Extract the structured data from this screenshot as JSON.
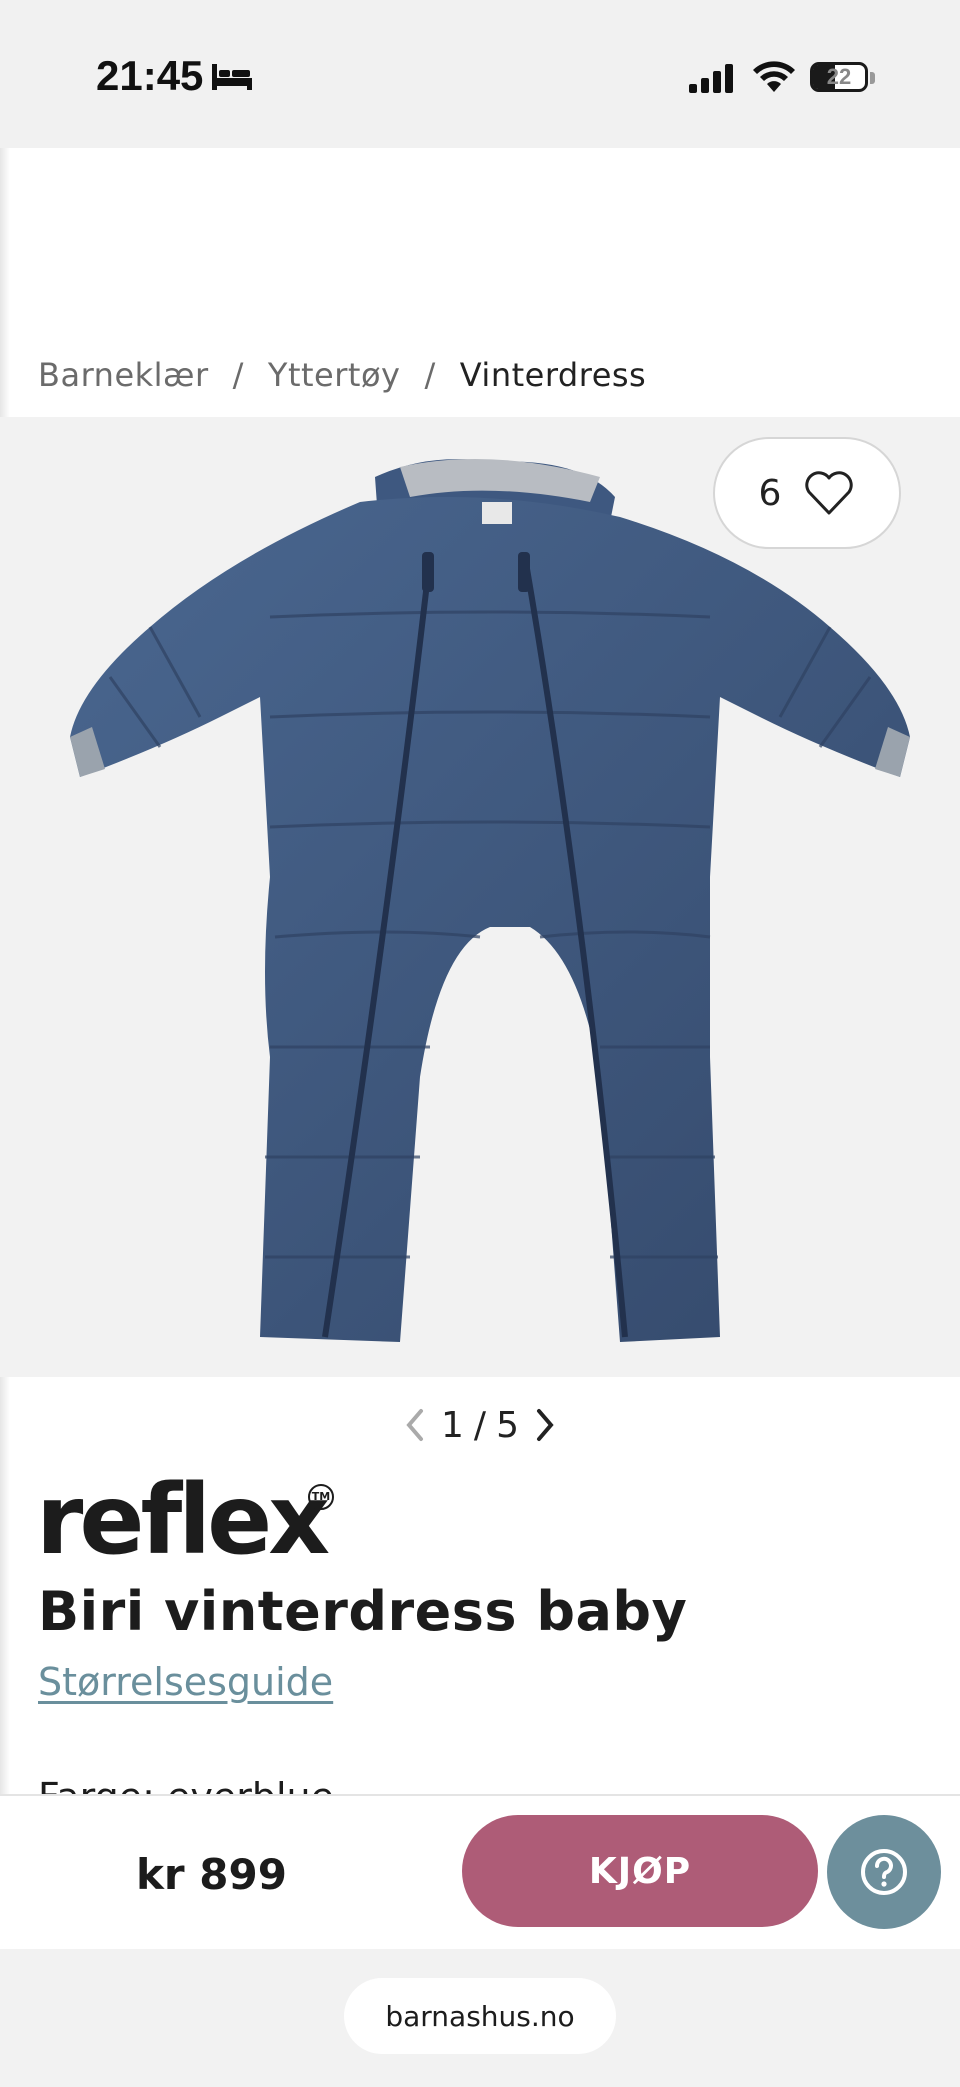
{
  "status_bar": {
    "time": "21:45",
    "battery": "22",
    "icons": [
      "bed-icon",
      "signal-icon",
      "wifi-icon",
      "battery-icon"
    ]
  },
  "breadcrumb": {
    "items": [
      "Barneklær",
      "Yttertøy",
      "Vinterdress"
    ],
    "separator": "/"
  },
  "gallery": {
    "favorite_count": "6",
    "current": "1",
    "separator": "/",
    "total": "5"
  },
  "product": {
    "brand": "reflex",
    "title": "Biri vinterdress baby",
    "size_guide_link": "Størrelsesguide",
    "color_line": "Farge: everblue",
    "image_color": "#3f5a7e"
  },
  "purchase_bar": {
    "price": "kr 899",
    "buy_label": "KJØP",
    "accent_color": "#ae5c77",
    "help_color": "#6d8f9c"
  },
  "browser": {
    "url": "barnashus.no"
  }
}
